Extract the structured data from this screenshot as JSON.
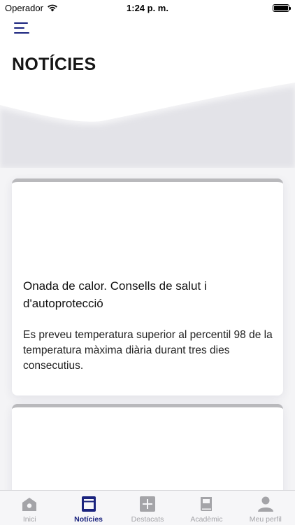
{
  "status_bar": {
    "carrier": "Operador",
    "time": "1:24 p. m."
  },
  "header": {
    "title": "NOTÍCIES"
  },
  "news": [
    {
      "title": "Onada de calor. Consells de salut i d'autoprotecció",
      "summary": "Es preveu temperatura superior al percentil 98 de la temperatura màxima diària durant tres dies consecutius."
    },
    {
      "title": "",
      "summary": ""
    }
  ],
  "tab_bar": {
    "items": [
      {
        "label": "Inici",
        "icon": "home-icon"
      },
      {
        "label": "Notícies",
        "icon": "news-icon",
        "active": true
      },
      {
        "label": "Destacats",
        "icon": "plus-icon"
      },
      {
        "label": "Acadèmic",
        "icon": "book-icon"
      },
      {
        "label": "Meu perfil",
        "icon": "user-icon"
      }
    ]
  },
  "colors": {
    "accent": "#1a237e",
    "inactive": "#a4a4a8",
    "background": "#f4f4f6"
  }
}
